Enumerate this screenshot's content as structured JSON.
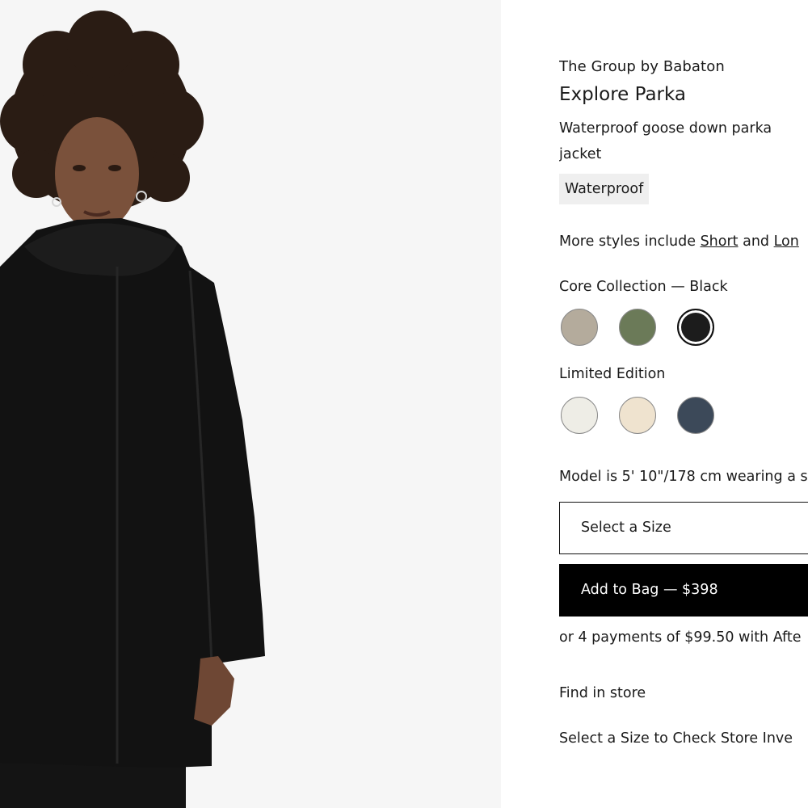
{
  "product": {
    "brand": "The Group by Babaton",
    "name": "Explore Parka",
    "description": "Waterproof goose down parka jacket",
    "badge": "Waterproof"
  },
  "styles": {
    "prefix": "More styles include ",
    "link1": "Short",
    "joiner": " and ",
    "link2": "Lon"
  },
  "core_collection": {
    "label": "Core Collection — Black",
    "swatches": [
      {
        "name": "taupe",
        "color": "#b4ab9c"
      },
      {
        "name": "olive",
        "color": "#6b7a58"
      },
      {
        "name": "black",
        "color": "#1c1c1c",
        "selected": true
      }
    ]
  },
  "limited_edition": {
    "label": "Limited Edition",
    "swatches": [
      {
        "name": "cream",
        "color": "#eeede6"
      },
      {
        "name": "ecru",
        "color": "#efe3cf"
      },
      {
        "name": "navy",
        "color": "#3c4959"
      }
    ]
  },
  "model_info": "Model is 5' 10\"/178 cm wearing a s",
  "size_select": {
    "placeholder": "Select a Size"
  },
  "add_to_bag": {
    "label": "Add to Bag — $398"
  },
  "payments": "or 4 payments of $99.50 with Afte",
  "find_in_store": "Find in store",
  "check_inventory": "Select a Size to Check Store Inve",
  "colors": {
    "image_bg": "#f6f6f6",
    "button_bg": "#000000"
  }
}
